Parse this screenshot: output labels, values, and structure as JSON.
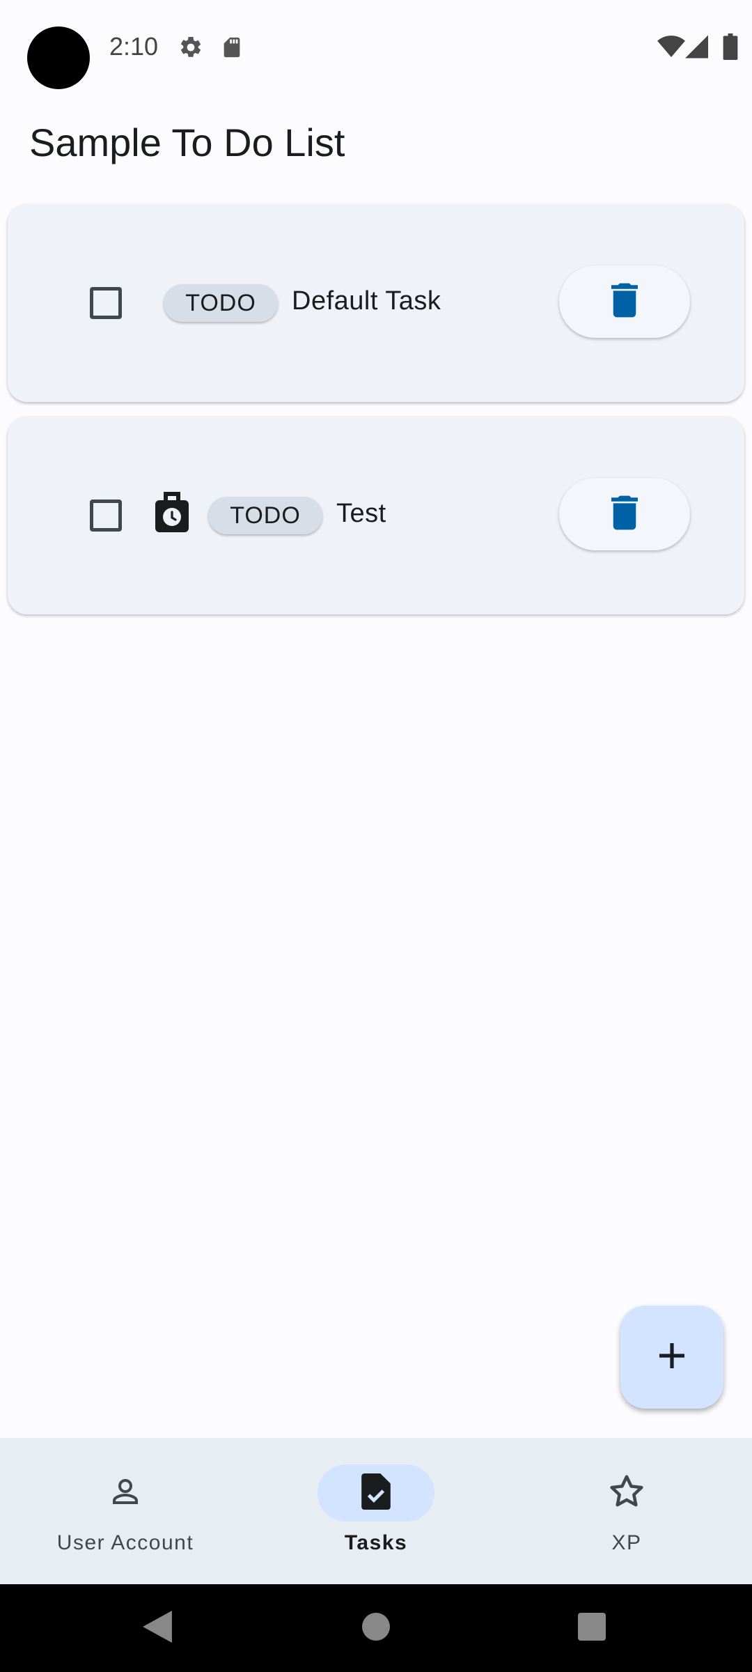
{
  "status_bar": {
    "time": "2:10",
    "icons": [
      "settings-icon",
      "sd-card-icon",
      "wifi-icon",
      "signal-icon",
      "battery-icon"
    ]
  },
  "page": {
    "title": "Sample To Do List"
  },
  "tasks": [
    {
      "status": "TODO",
      "title": "Default Task",
      "checked": false,
      "has_timer": false
    },
    {
      "status": "TODO",
      "title": "Test",
      "checked": false,
      "has_timer": true
    }
  ],
  "fab": {
    "icon": "plus-icon"
  },
  "bottom_nav": {
    "items": [
      {
        "label": "User Account",
        "icon": "person-icon",
        "active": false
      },
      {
        "label": "Tasks",
        "icon": "task-document-icon",
        "active": true
      },
      {
        "label": "XP",
        "icon": "star-icon",
        "active": false
      }
    ]
  },
  "colors": {
    "background": "#fcfcff",
    "card": "#eff2f8",
    "chip": "#d8dee8",
    "accent": "#0061a4",
    "fab": "#d2e4ff",
    "nav_bar": "#e8edf4"
  }
}
